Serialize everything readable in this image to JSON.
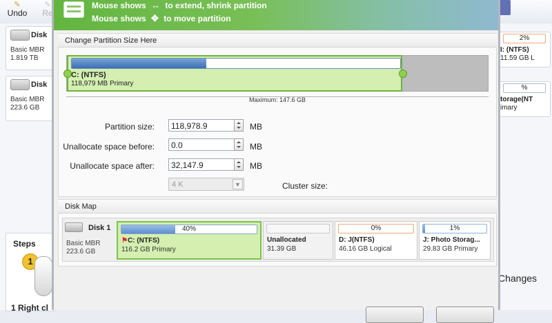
{
  "toolbar": {
    "undo_label": "Undo",
    "redo_label": "Re"
  },
  "left_disks": [
    {
      "name": "Disk",
      "type": "Basic MBR",
      "size": "1.819 TB"
    },
    {
      "name": "Disk",
      "type": "Basic MBR",
      "size": "223.6 GB"
    }
  ],
  "steps": {
    "title": "Steps",
    "badge": "1",
    "text": "1 Right cl"
  },
  "right_cards": [
    {
      "percent": "2%",
      "name": "I: (NTFS)",
      "info": "11.59 GB L"
    },
    {
      "percent": "%",
      "name": "torage(NT",
      "info": "imary"
    }
  ],
  "apply_changes_text": "Changes",
  "banner": {
    "line1_prefix": "Mouse shows",
    "line1_arrow": "↔",
    "line1_suffix": "to extend, shrink partition",
    "line2_prefix": "Mouse shows",
    "line2_arrow": "✥",
    "line2_suffix": "to move partition"
  },
  "resize_group": {
    "title": "Change Partition Size Here",
    "partition_name": "C: (NTFS)",
    "partition_info": "118,979 MB Primary",
    "used_fraction": 0.41,
    "partition_fraction_of_max": 0.787,
    "maximum_label": "Maximum: 147.6 GB"
  },
  "form": {
    "partition_size_label": "Partition size:",
    "partition_size_value": "118,978.9",
    "before_label": "Unallocate space before:",
    "before_value": "0.0",
    "after_label": "Unallocate space after:",
    "after_value": "32,147.9",
    "unit": "MB",
    "cluster_value": "4 K",
    "cluster_label": "Cluster size:"
  },
  "disk_map": {
    "title": "Disk Map",
    "disk_name": "Disk 1",
    "disk_type": "Basic MBR",
    "disk_size": "223.6 GB",
    "partitions": [
      {
        "percent": "40%",
        "used_fraction": 0.4,
        "name": "C: (NTFS)",
        "info": "116.2 GB Primary"
      },
      {
        "percent": "",
        "used_fraction": 0,
        "name": "Unallocated",
        "info": "31.39 GB"
      },
      {
        "percent": "0%",
        "used_fraction": 0,
        "name": "D: J(NTFS)",
        "info": "46.16 GB Logical"
      },
      {
        "percent": "1%",
        "used_fraction": 0.01,
        "name": "J: Photo Storag...",
        "info": "29.83 GB Primary"
      }
    ]
  }
}
